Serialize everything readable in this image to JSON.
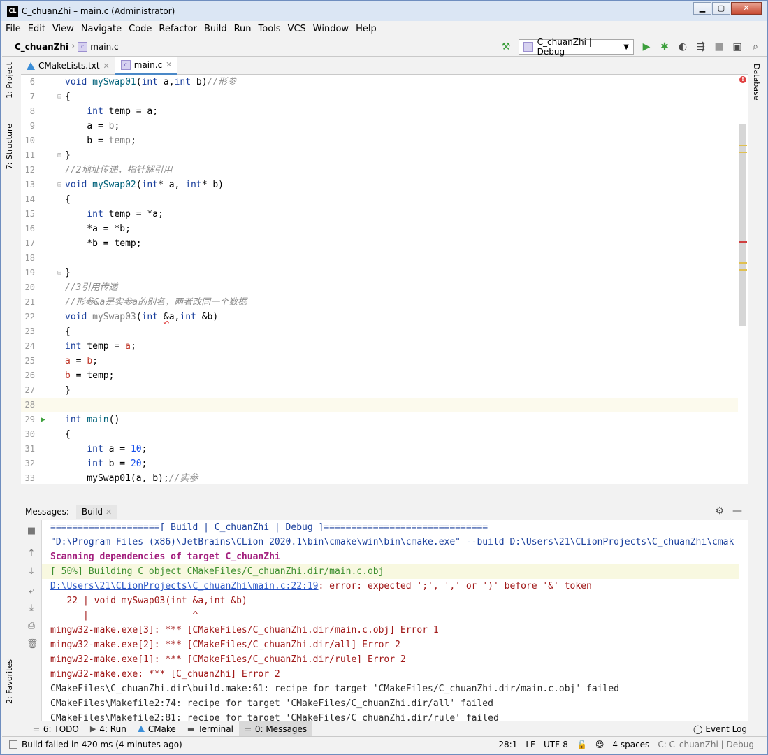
{
  "window": {
    "title": "C_chuanZhi – main.c (Administrator)",
    "app_logo": "CL",
    "minimize": "▁",
    "maximize": "▢",
    "close": "✕"
  },
  "menu": [
    "File",
    "Edit",
    "View",
    "Navigate",
    "Code",
    "Refactor",
    "Build",
    "Run",
    "Tools",
    "VCS",
    "Window",
    "Help"
  ],
  "navbar": {
    "project": "C_chuanZhi",
    "file": "main.c",
    "file_icon_text": "c",
    "run_config": "C_chuanZhi | Debug"
  },
  "side_tabs": {
    "project": "1: Project",
    "structure": "7: Structure",
    "favorites": "2: Favorites",
    "database": "Database"
  },
  "tabs": [
    {
      "label": "CMakeLists.txt",
      "active": false
    },
    {
      "label": "main.c",
      "active": true
    }
  ],
  "editor_lines": [
    {
      "n": "6",
      "code": "void mySwap01(int a,int b)//形参"
    },
    {
      "n": "7",
      "code": "{"
    },
    {
      "n": "8",
      "code": "    int temp = a;"
    },
    {
      "n": "9",
      "code": "    a = b;"
    },
    {
      "n": "10",
      "code": "    b = temp;"
    },
    {
      "n": "11",
      "code": "}"
    },
    {
      "n": "12",
      "code": "//2地址传递，指针解引用"
    },
    {
      "n": "13",
      "code": "void mySwap02(int* a, int* b)"
    },
    {
      "n": "14",
      "code": "{"
    },
    {
      "n": "15",
      "code": "    int temp = *a;"
    },
    {
      "n": "16",
      "code": "    *a = *b;"
    },
    {
      "n": "17",
      "code": "    *b = temp;"
    },
    {
      "n": "18",
      "code": ""
    },
    {
      "n": "19",
      "code": "}"
    },
    {
      "n": "20",
      "code": "//3引用传递"
    },
    {
      "n": "21",
      "code": "//形参&a是实参a的别名，两者改同一个数据"
    },
    {
      "n": "22",
      "code": "void mySwap03(int &a,int &b)"
    },
    {
      "n": "23",
      "code": "{"
    },
    {
      "n": "24",
      "code": "int temp = a;"
    },
    {
      "n": "25",
      "code": "a = b;"
    },
    {
      "n": "26",
      "code": "b = temp;"
    },
    {
      "n": "27",
      "code": "}"
    },
    {
      "n": "28",
      "code": ""
    },
    {
      "n": "29",
      "code": "int main()"
    },
    {
      "n": "30",
      "code": "{"
    },
    {
      "n": "31",
      "code": "    int a = 10;"
    },
    {
      "n": "32",
      "code": "    int b = 20;"
    },
    {
      "n": "33",
      "code": "    mySwap01(a, b);//实参"
    }
  ],
  "messages": {
    "title": "Messages:",
    "tab": "Build",
    "lines": [
      "====================[ Build | C_chuanZhi | Debug ]==============================",
      "\"D:\\Program Files (x86)\\JetBrains\\CLion 2020.1\\bin\\cmake\\win\\bin\\cmake.exe\" --build D:\\Users\\21\\CLionProjects\\C_chuanZhi\\cmak",
      "Scanning dependencies of target C_chuanZhi",
      "[ 50%] Building C object CMakeFiles/C_chuanZhi.dir/main.c.obj",
      "D:\\Users\\21\\CLionProjects\\C_chuanZhi\\main.c:22:19",
      ": error: expected ';', ',' or ')' before '&' token",
      "   22 | void mySwap03(int &a,int &b)",
      "      |                   ^",
      "mingw32-make.exe[3]: *** [CMakeFiles/C_chuanZhi.dir/main.c.obj] Error 1",
      "mingw32-make.exe[2]: *** [CMakeFiles/C_chuanZhi.dir/all] Error 2",
      "mingw32-make.exe[1]: *** [CMakeFiles/C_chuanZhi.dir/rule] Error 2",
      "mingw32-make.exe: *** [C_chuanZhi] Error 2",
      "CMakeFiles\\C_chuanZhi.dir\\build.make:61: recipe for target 'CMakeFiles/C_chuanZhi.dir/main.c.obj' failed",
      "CMakeFiles\\Makefile2:74: recipe for target 'CMakeFiles/C_chuanZhi.dir/all' failed",
      "CMakeFiles\\Makefile2:81: recipe for target 'CMakeFiles/C_chuanZhi.dir/rule' failed"
    ]
  },
  "bottom_tabs": [
    {
      "num": "6",
      "label": ": TODO",
      "icon": "list-icon"
    },
    {
      "num": "4",
      "label": ": Run",
      "icon": "play-icon"
    },
    {
      "num": "",
      "label": "CMake",
      "icon": "cmake-icon"
    },
    {
      "num": "",
      "label": "Terminal",
      "icon": "terminal-icon"
    },
    {
      "num": "0",
      "label": ": Messages",
      "icon": "messages-icon"
    }
  ],
  "event_log": "Event Log",
  "status": {
    "message": "Build failed in 420 ms (4 minutes ago)",
    "position": "28:1",
    "line_sep": "LF",
    "encoding": "UTF-8",
    "indent": "4 spaces",
    "context": "C: C_chuanZhi | Debug"
  }
}
